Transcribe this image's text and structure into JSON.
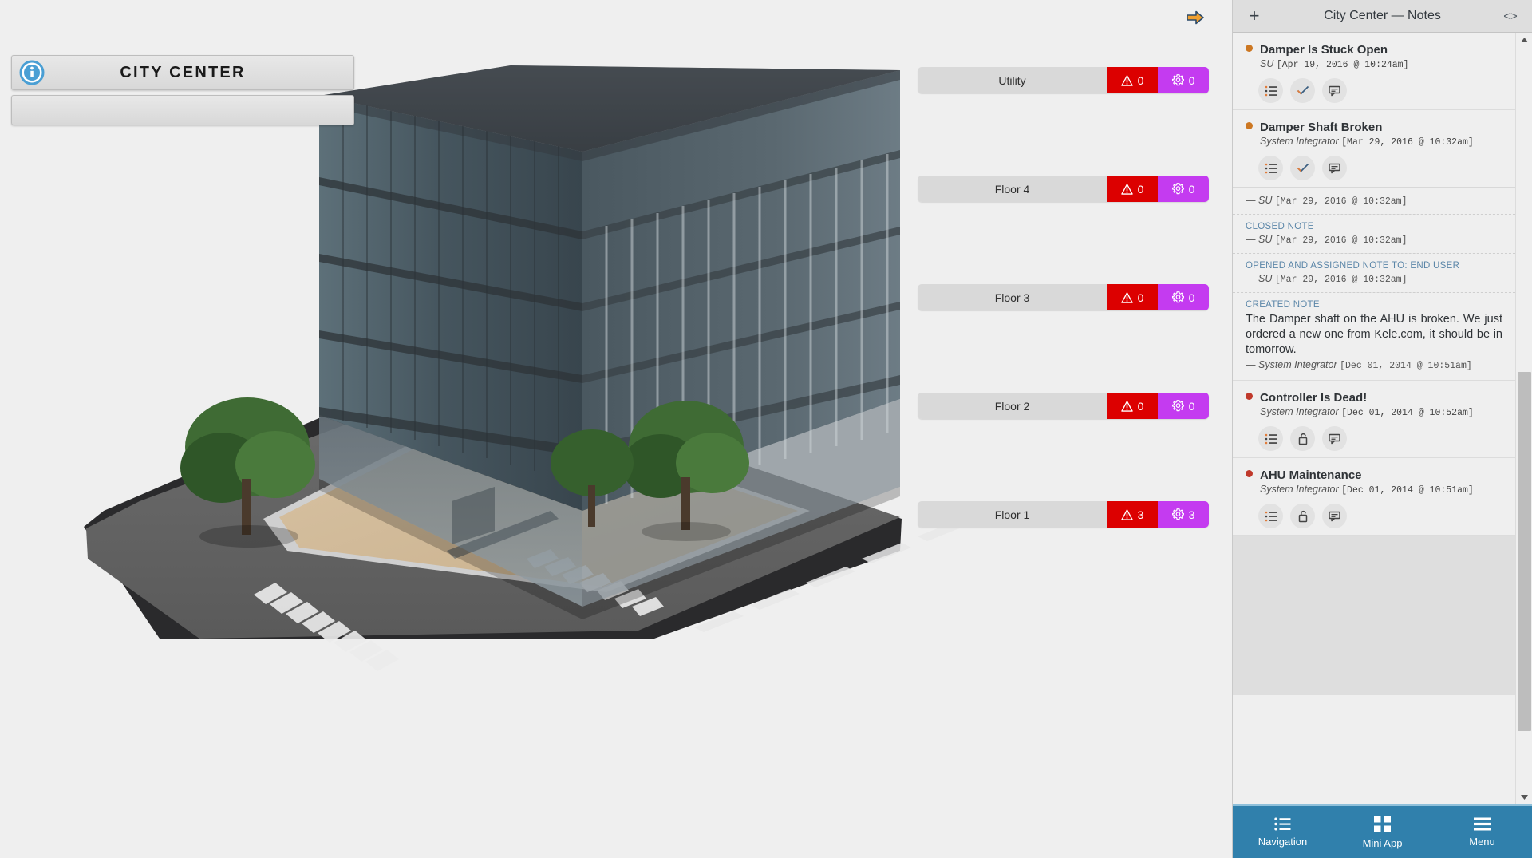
{
  "viewport": {
    "share_icon": "arrow-right-icon",
    "title_widget": {
      "info_icon": "info-circle-icon",
      "title": "CITY CENTER",
      "subtitle": ""
    }
  },
  "floors": {
    "alarm_color": "#dc0000",
    "point_color": "#c43bf0",
    "rows": [
      {
        "label": "Utility",
        "alarm_count": "0",
        "point_count": "0"
      },
      {
        "label": "Floor 4",
        "alarm_count": "0",
        "point_count": "0"
      },
      {
        "label": "Floor 3",
        "alarm_count": "0",
        "point_count": "0"
      },
      {
        "label": "Floor 2",
        "alarm_count": "0",
        "point_count": "0"
      },
      {
        "label": "Floor 1",
        "alarm_count": "3",
        "point_count": "3"
      }
    ]
  },
  "notes_panel": {
    "header": {
      "add_label": "+",
      "title": "City Center — Notes",
      "code_label": "<>"
    },
    "dot_colors": {
      "open": "#cc7722",
      "closed": "#c0392b"
    },
    "notes": [
      {
        "title": "Damper Is Stuck Open",
        "author": "SU",
        "timestamp": "[Apr 19, 2016 @ 10:24am]",
        "dot": "open",
        "actions": [
          "list-icon",
          "check-icon",
          "comment-icon"
        ],
        "log": []
      },
      {
        "title": "Damper Shaft Broken",
        "author": "System Integrator",
        "timestamp": "[Mar 29, 2016 @ 10:32am]",
        "dot": "open",
        "actions": [
          "list-icon",
          "check-icon",
          "comment-icon"
        ],
        "log": [
          {
            "label": "",
            "body": "",
            "author": "SU",
            "timestamp": "[Mar 29, 2016 @ 10:32am]"
          },
          {
            "label": "CLOSED NOTE",
            "body": "",
            "author": "SU",
            "timestamp": "[Mar 29, 2016 @ 10:32am]"
          },
          {
            "label": "OPENED AND ASSIGNED NOTE TO: END USER",
            "body": "",
            "author": "SU",
            "timestamp": "[Mar 29, 2016 @ 10:32am]"
          },
          {
            "label": "CREATED NOTE",
            "body": "The Damper shaft on the AHU is broken. We just ordered a new one from Kele.com, it should be in tomorrow.",
            "author": "System Integrator",
            "timestamp": "[Dec 01, 2014 @ 10:51am]"
          }
        ]
      },
      {
        "title": "Controller Is Dead!",
        "author": "System Integrator",
        "timestamp": "[Dec 01, 2014 @ 10:52am]",
        "dot": "closed",
        "actions": [
          "list-icon",
          "unlock-icon",
          "comment-icon"
        ],
        "log": []
      },
      {
        "title": "AHU Maintenance",
        "author": "System Integrator",
        "timestamp": "[Dec 01, 2014 @ 10:51am]",
        "dot": "closed",
        "actions": [
          "list-icon",
          "unlock-icon",
          "comment-icon"
        ],
        "log": []
      }
    ],
    "scrollbar": {
      "up_icon": "triangle-up-icon",
      "down_icon": "triangle-down-icon"
    }
  },
  "bottom_nav": {
    "background": "#3080ac",
    "items": [
      {
        "icon": "list-icon",
        "label": "Navigation"
      },
      {
        "icon": "grid-icon",
        "label": "Mini App"
      },
      {
        "icon": "hamburger-icon",
        "label": "Menu"
      }
    ]
  }
}
